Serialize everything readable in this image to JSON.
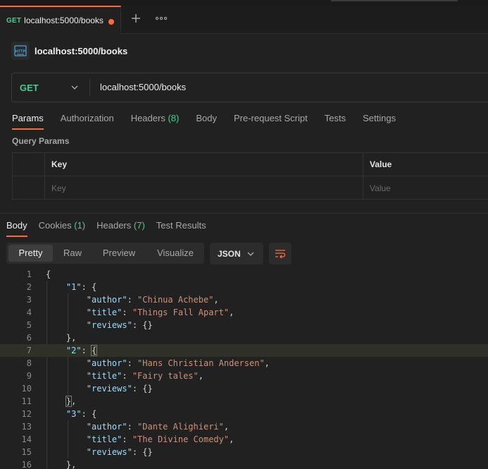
{
  "tab": {
    "method": "GET",
    "title": "localhost:5000/books",
    "icon_plus": "plus-icon",
    "icon_more": "more-horizontal-icon"
  },
  "request": {
    "icon": "http-icon",
    "name": "localhost:5000/books",
    "method": "GET",
    "url": "localhost:5000/books"
  },
  "request_tabs": [
    {
      "label": "Params",
      "count": ""
    },
    {
      "label": "Authorization",
      "count": ""
    },
    {
      "label": "Headers",
      "count": "(8)"
    },
    {
      "label": "Body",
      "count": ""
    },
    {
      "label": "Pre-request Script",
      "count": ""
    },
    {
      "label": "Tests",
      "count": ""
    },
    {
      "label": "Settings",
      "count": ""
    }
  ],
  "query_params": {
    "title": "Query Params",
    "key_header": "Key",
    "value_header": "Value",
    "key_placeholder": "Key",
    "value_placeholder": "Value"
  },
  "response_tabs": [
    {
      "label": "Body",
      "count": ""
    },
    {
      "label": "Cookies",
      "count": "(1)"
    },
    {
      "label": "Headers",
      "count": "(7)"
    },
    {
      "label": "Test Results",
      "count": ""
    }
  ],
  "view_options": [
    "Pretty",
    "Raw",
    "Preview",
    "Visualize"
  ],
  "format": "JSON",
  "line_numbers": [
    "1",
    "2",
    "3",
    "4",
    "5",
    "6",
    "7",
    "8",
    "9",
    "10",
    "11",
    "12",
    "13",
    "14",
    "15",
    "16"
  ],
  "books": [
    {
      "id": "\"1\"",
      "author": "\"Chinua Achebe\"",
      "title": "\"Things Fall Apart\"",
      "reviews": "{}"
    },
    {
      "id": "\"2\"",
      "author": "\"Hans Christian Andersen\"",
      "title": "\"Fairy tales\"",
      "reviews": "{}"
    },
    {
      "id": "\"3\"",
      "author": "\"Dante Alighieri\"",
      "title": "\"The Divine Comedy\"",
      "reviews": "{}"
    }
  ],
  "keys": {
    "author": "\"author\"",
    "title": "\"title\"",
    "reviews": "\"reviews\""
  },
  "colors": {
    "accent": "#ff6c37",
    "method_get": "#49cc90",
    "json_key": "#9cdcfe",
    "json_string": "#ce9178"
  }
}
